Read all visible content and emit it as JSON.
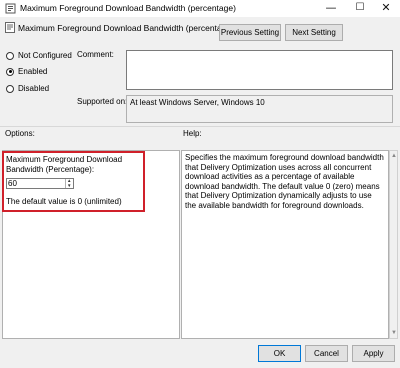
{
  "window": {
    "title": "Maximum Foreground Download Bandwidth (percentage)",
    "controls": {
      "minimize": "—",
      "maximize": "☐",
      "close": "✕"
    }
  },
  "header": {
    "policy_title": "Maximum Foreground Download Bandwidth (percentage)",
    "prev_label": "Previous Setting",
    "next_label": "Next Setting"
  },
  "state": {
    "options": [
      {
        "label": "Not Configured",
        "checked": false
      },
      {
        "label": "Enabled",
        "checked": true
      },
      {
        "label": "Disabled",
        "checked": false
      }
    ]
  },
  "comment": {
    "label": "Comment:",
    "value": ""
  },
  "supported": {
    "label": "Supported on:",
    "value": "At least Windows Server, Windows 10"
  },
  "options_section": {
    "title": "Options:",
    "field_label": "Maximum Foreground Download Bandwidth (Percentage):",
    "value": "60",
    "note": "The default value is 0 (unlimited)"
  },
  "help_section": {
    "title": "Help:",
    "text": "Specifies the maximum foreground download bandwidth that Delivery Optimization uses across all concurrent download activities as a percentage of available download bandwidth. The default value 0 (zero) means that Delivery Optimization dynamically adjusts to use the available bandwidth for foreground downloads."
  },
  "footer": {
    "ok_label": "OK",
    "cancel_label": "Cancel",
    "apply_label": "Apply"
  },
  "colors": {
    "highlight_border": "#d0202a",
    "ok_border": "#0078d7"
  }
}
